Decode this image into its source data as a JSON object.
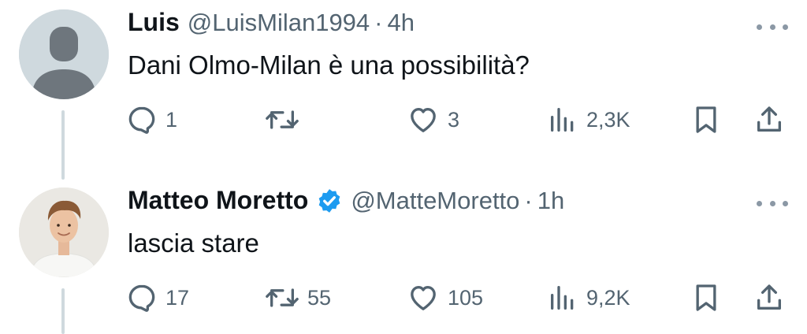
{
  "tweets": [
    {
      "name": "Luis",
      "handle": "@LuisMilan1994",
      "separator": "·",
      "time": "4h",
      "text": "Dani Olmo-Milan è una possibilità?",
      "verified": false,
      "avatar": "default-avatar",
      "stats": {
        "replies": "1",
        "retweets": "",
        "likes": "3",
        "views": "2,3K"
      }
    },
    {
      "name": "Matteo Moretto",
      "handle": "@MatteMoretto",
      "separator": "·",
      "time": "1h",
      "text": "lascia stare",
      "verified": true,
      "avatar": "profile-photo",
      "stats": {
        "replies": "17",
        "retweets": "55",
        "likes": "105",
        "views": "9,2K"
      }
    }
  ],
  "colors": {
    "text_primary": "#0f1419",
    "text_secondary": "#536471",
    "verified_blue": "#1d9bf0",
    "thread_line": "#cfd9de"
  },
  "icons": [
    "more-icon",
    "reply-icon",
    "retweet-icon",
    "like-icon",
    "views-icon",
    "bookmark-icon",
    "share-icon",
    "verified-badge-icon"
  ]
}
